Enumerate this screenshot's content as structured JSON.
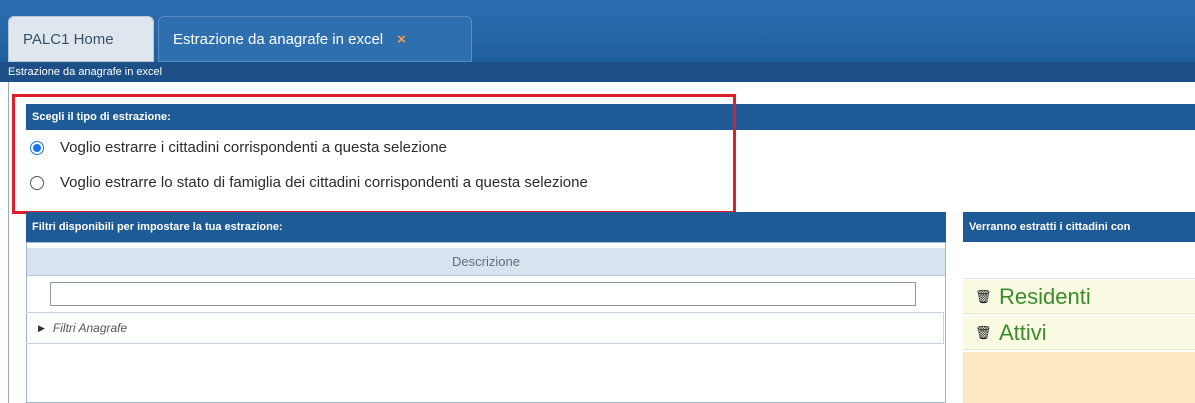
{
  "tabs": [
    {
      "label": "PALC1 Home"
    },
    {
      "label": "Estrazione da anagrafe in excel"
    }
  ],
  "tab_close_glyph": "×",
  "breadcrumb": "Estrazione da anagrafe in excel",
  "extraction_type": {
    "header": "Scegli il tipo di estrazione:",
    "options": [
      {
        "label": "Voglio estrarre i cittadini corrispondenti a questa selezione",
        "checked": true
      },
      {
        "label": "Voglio estrarre lo stato di famiglia dei cittadini corrispondenti a questa selezione",
        "checked": false
      }
    ]
  },
  "filters_panel": {
    "header": "Filtri disponibili per impostare la tua estrazione:",
    "column_header": "Descrizione",
    "filter_value": "",
    "tree_items": [
      {
        "label": "Filtri Anagrafe",
        "icon": "caret-right-icon"
      }
    ]
  },
  "results_panel": {
    "header": "Verranno estratti i cittadini con",
    "rows": [
      {
        "label": "Residenti",
        "icon": "trash-icon"
      },
      {
        "label": "Attivi",
        "icon": "trash-icon"
      }
    ]
  },
  "colors": {
    "accent_blue": "#1e5a95",
    "highlight_red": "#e01e2b",
    "result_green": "#3a8c2a",
    "result_row_bg": "#fbfbe4",
    "empty_area_bg": "#fde9c4"
  }
}
